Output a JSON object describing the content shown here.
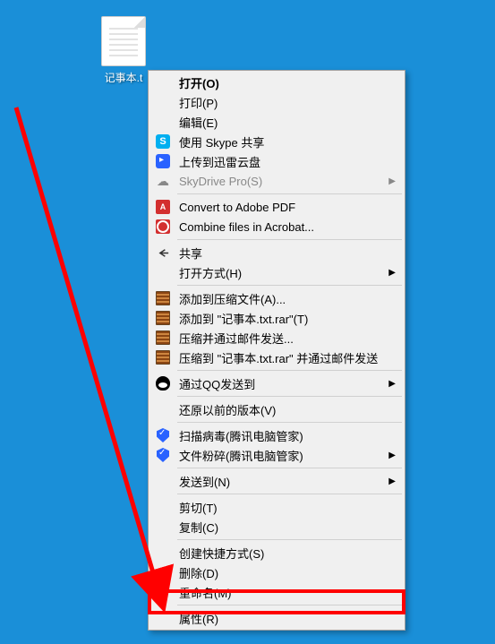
{
  "desktop": {
    "file_label": "记事本.t"
  },
  "menu": {
    "open": "打开(O)",
    "print": "打印(P)",
    "edit": "编辑(E)",
    "skype": "使用 Skype 共享",
    "thunder": "上传到迅雷云盘",
    "skydrive": "SkyDrive Pro(S)",
    "convert_pdf": "Convert to Adobe PDF",
    "combine_acrobat": "Combine files in Acrobat...",
    "share": "共享",
    "open_with": "打开方式(H)",
    "add_to_zip": "添加到压缩文件(A)...",
    "add_to_rar": "添加到 \"记事本.txt.rar\"(T)",
    "zip_email": "压缩并通过邮件发送...",
    "rar_email": "压缩到 \"记事本.txt.rar\" 并通过邮件发送",
    "qq_send": "通过QQ发送到",
    "restore": "还原以前的版本(V)",
    "scan_virus": "扫描病毒(腾讯电脑管家)",
    "shred": "文件粉碎(腾讯电脑管家)",
    "send_to": "发送到(N)",
    "cut": "剪切(T)",
    "copy": "复制(C)",
    "shortcut": "创建快捷方式(S)",
    "delete": "删除(D)",
    "rename": "重命名(M)",
    "properties": "属性(R)"
  }
}
